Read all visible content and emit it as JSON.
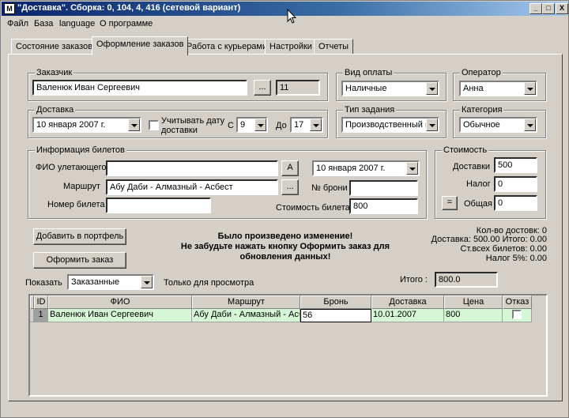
{
  "window": {
    "title": "\"Доставка\". Сборка: 0, 104, 4, 416 (сетевой вариант)",
    "icon_text": "M",
    "btn_min": "_",
    "btn_max": "□",
    "btn_close": "X"
  },
  "menu": [
    "Файл",
    "База",
    "language",
    "О программе"
  ],
  "tabs": [
    "Состояние заказов",
    "Оформление заказов",
    "Работа с курьерами",
    "Настройки",
    "Отчеты"
  ],
  "customer": {
    "group": "Заказчик",
    "name": "Валенюк Иван Сергеевич",
    "browse": "...",
    "id": "11"
  },
  "payment": {
    "group": "Вид оплаты",
    "value": "Наличные"
  },
  "operator": {
    "group": "Оператор",
    "value": "Анна"
  },
  "delivery": {
    "group": "Доставка",
    "date": "10  января   2007 г.",
    "consider_label": "Учитывать дату доставки",
    "from_label": "С",
    "from_value": "9",
    "to_label": "До",
    "to_value": "17"
  },
  "task_type": {
    "group": "Тип задания",
    "value": "Производственный вь"
  },
  "category": {
    "group": "Категория",
    "value": "Обычное"
  },
  "tickets": {
    "group": "Информация билетов",
    "passenger_label": "ФИО улетающего",
    "passenger_value": "",
    "a_button": "A",
    "date": "10  января   2007 г.",
    "route_label": "Маршрут",
    "route_value": "Абу Даби - Алмазный - Асбест",
    "route_browse": "...",
    "booking_label": "№ брони",
    "booking_value": "",
    "ticket_no_label": "Номер билета",
    "ticket_no_value": "",
    "ticket_cost_label": "Стоимость билета",
    "ticket_cost_value": "800"
  },
  "cost": {
    "group": "Стоимость",
    "delivery_label": "Доставки",
    "delivery_value": "500",
    "tax_label": "Налог",
    "tax_value": "0",
    "eq_button": "=",
    "total_label": "Общая",
    "total_value": "0"
  },
  "actions": {
    "add_to_portfolio": "Добавить в портфель",
    "place_order": "Оформить заказ"
  },
  "warning": [
    "Было произведено изменение!",
    "Не забудьте нажать кнопку Оформить заказ для",
    "обновления данных!"
  ],
  "summary": [
    "Кол-во достовк: 0",
    "Доставка: 500.00 Итого: 0.00",
    "Ст.всех билетов: 0.00",
    "Налог 5%: 0.00"
  ],
  "show": {
    "label": "Показать",
    "value": "Заказанные",
    "readonly_label": "Только для просмотра"
  },
  "total": {
    "label": "Итого :",
    "value": "800.0"
  },
  "table": {
    "columns": [
      "ID",
      "ФИО",
      "Маршрут",
      "Бронь",
      "Доставка",
      "Цена",
      "Отказ"
    ],
    "rows": [
      {
        "num": "1",
        "id": "",
        "name": "Валенюк Иван Сергеевич",
        "route": "Абу Даби - Алмазный - Асбест",
        "booking": "56",
        "delivery": "10.01.2007",
        "price": "800"
      }
    ]
  }
}
